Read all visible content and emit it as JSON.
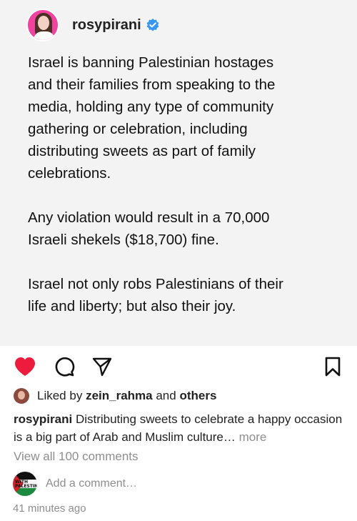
{
  "post": {
    "username": "rosypirani",
    "verified": true,
    "image_text": "Israel is banning Palestinian hostages\nand their families from speaking to the\nmedia, holding any type of community\ngathering or celebration, including\ndistributing sweets as part of family\ncelebrations.\n\nAny violation would result in a 70,000\nIsraeli shekels ($18,700) fine.\n\nIsrael not only robs Palestinians of their\nlife and liberty; but also their joy."
  },
  "actions": {
    "like_icon": "heart-filled-icon",
    "comment_icon": "comment-bubble-icon",
    "share_icon": "send-paper-plane-icon",
    "save_icon": "bookmark-icon",
    "like_color": "#ed1c3c"
  },
  "likes": {
    "prefix": "Liked by",
    "user": "zein_rahma",
    "conjunction": "and",
    "others": "others"
  },
  "caption": {
    "username": "rosypirani",
    "text": "Distributing sweets to celebrate a happy occasion is a big part of Arab and Muslim culture…",
    "more": "more"
  },
  "comments": {
    "view_all": "View all 100 comments",
    "add_placeholder": "Add a comment…",
    "my_avatar_text": "WITH PALESTINE"
  },
  "timestamp": "41 minutes ago"
}
